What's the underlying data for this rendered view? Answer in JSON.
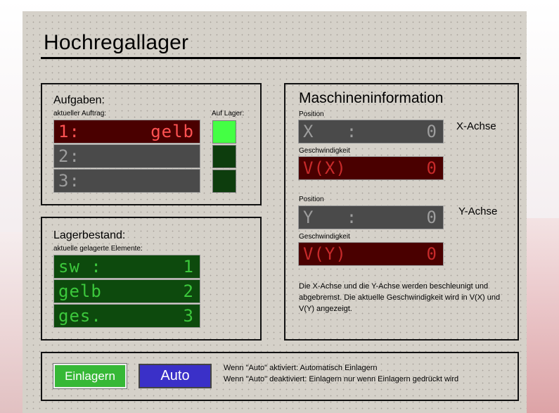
{
  "title": "Hochregallager",
  "aufgaben": {
    "header": "Aufgaben:",
    "sub_label": "aktueller Auftrag:",
    "lager_label": "Auf Lager:",
    "rows": [
      {
        "left": "1:",
        "right": "gelb",
        "state": "active"
      },
      {
        "left": "2:",
        "right": "",
        "state": "idle"
      },
      {
        "left": "3:",
        "right": "",
        "state": "idle"
      }
    ],
    "indicators": [
      {
        "state": "on",
        "color": "#44ff44"
      },
      {
        "state": "off",
        "color": "#0d3d0d"
      },
      {
        "state": "off",
        "color": "#0d3d0d"
      }
    ]
  },
  "lagerbestand": {
    "header": "Lagerbestand:",
    "sub_label": "aktuelle gelagerte Elemente:",
    "rows": [
      {
        "left": "sw :",
        "right": "1"
      },
      {
        "left": "gelb",
        "right": "2"
      },
      {
        "left": "ges.",
        "right": "3"
      }
    ]
  },
  "maschine": {
    "header": "Maschineninformation",
    "x_axis": {
      "position_label": "Position",
      "position_left": "X   :",
      "position_value": "0",
      "axis_label": "X-Achse",
      "speed_label": "Geschwindigkeit",
      "speed_left": "V(X)",
      "speed_value": "0"
    },
    "y_axis": {
      "position_label": "Position",
      "position_left": "Y   :",
      "position_value": "0",
      "axis_label": "Y-Achse",
      "speed_label": "Geschwindigkeit",
      "speed_left": "V(Y)",
      "speed_value": "0"
    },
    "info_text": "Die X-Achse und die Y-Achse werden beschleunigt und abgebremst. Die aktuelle Geschwindigkeit wird in V(X) und V(Y) angezeigt."
  },
  "controls": {
    "einlagern_label": "Einlagern",
    "auto_label": "Auto",
    "note_line1": "Wenn \"Auto\" aktiviert: Automatisch Einlagern",
    "note_line2": "Wenn \"Auto\" deaktiviert: Einlagern nur wenn Einlagern gedrückt wird"
  },
  "colors": {
    "panel_bg": "#d5d1c9",
    "display_red": "#4a0000",
    "display_gray": "#4a4a4a",
    "display_green": "#0d4a0d",
    "indicator_on": "#44ff44",
    "indicator_off": "#0d3d0d",
    "einlagern_button": "#36b836",
    "auto_button": "#3a30c8"
  }
}
